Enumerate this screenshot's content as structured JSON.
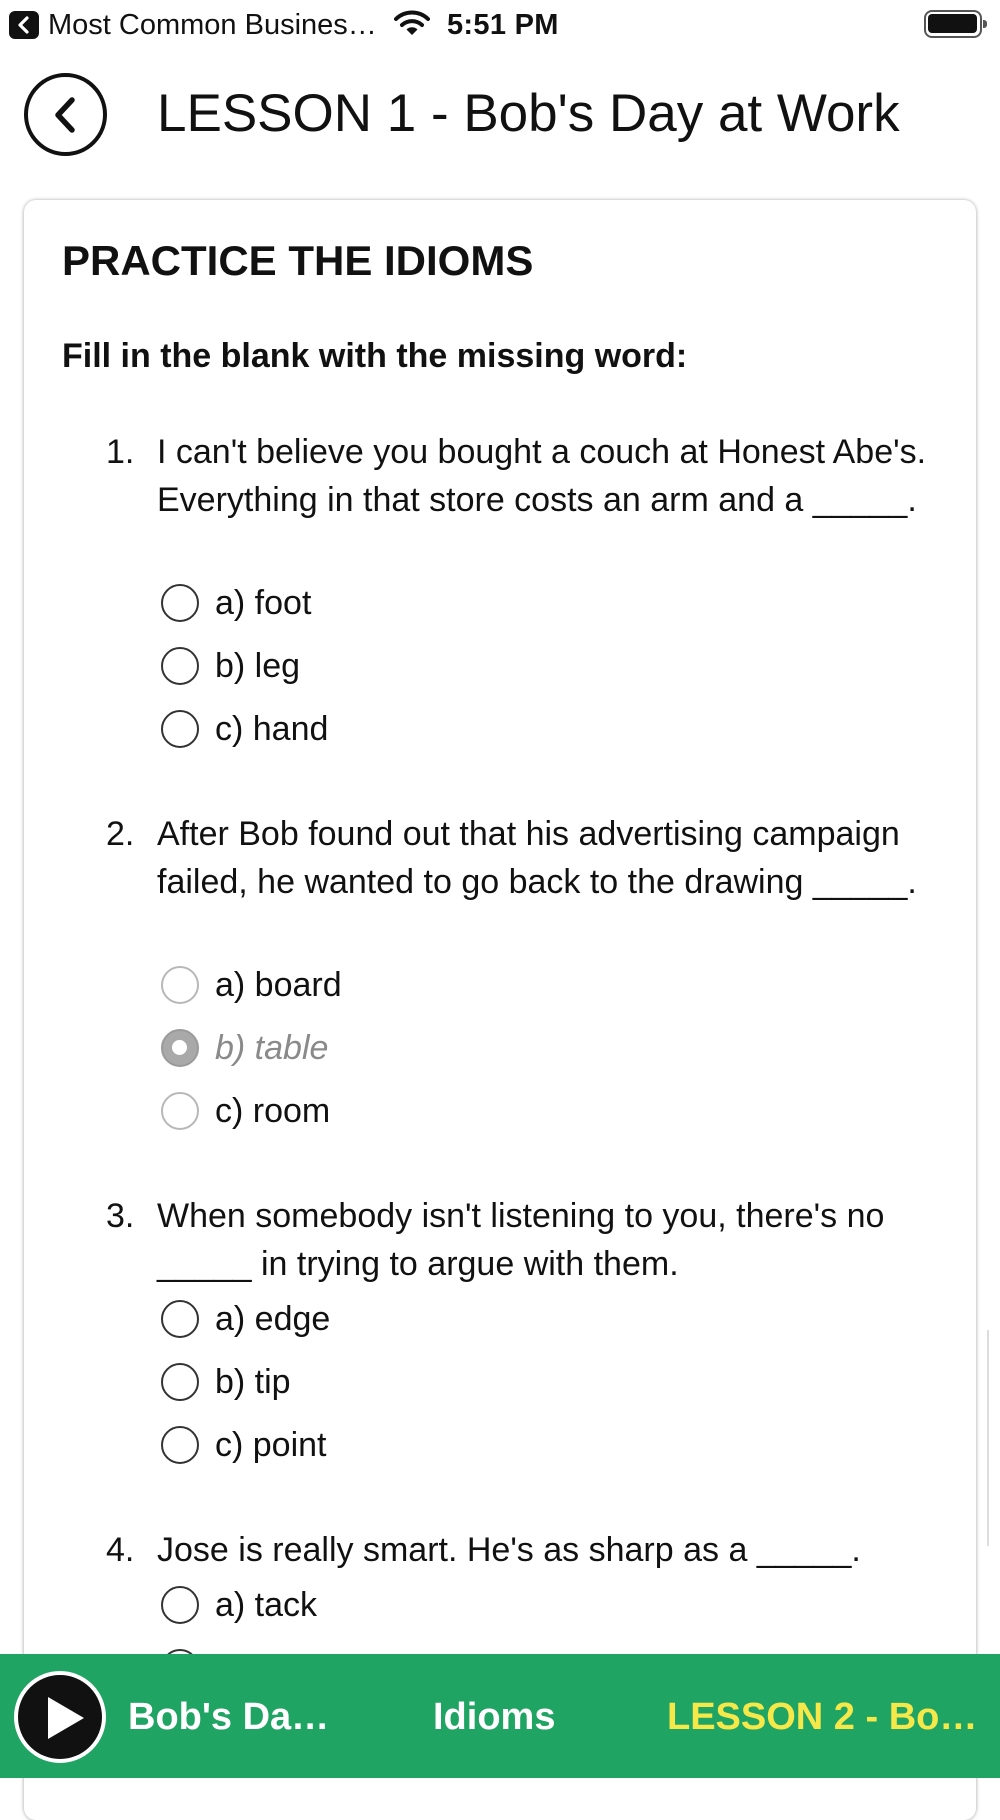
{
  "status_bar": {
    "back_app_name": "Most Common Busines…",
    "time": "5:51 PM"
  },
  "header": {
    "title": "LESSON 1 - Bob's Day at Work"
  },
  "section": {
    "title": "PRACTICE THE IDIOMS",
    "instruction": "Fill in the blank with the missing word:"
  },
  "questions": [
    {
      "number": "1.",
      "text": "I can't believe you bought a couch at Honest Abe's. Everything in that store costs an arm and a _____.",
      "options": [
        "a) foot",
        "b) leg",
        "c) hand"
      ],
      "selected": null
    },
    {
      "number": "2.",
      "text": "After Bob found out that his advertising campaign failed, he wanted to go back to the drawing _____.",
      "options": [
        "a) board",
        "b) table",
        "c) room"
      ],
      "selected": "b) table"
    },
    {
      "number": "3.",
      "text": "When somebody isn't listening to you, there's no _____ in trying to argue with them.",
      "options": [
        "a) edge",
        "b) tip",
        "c) point"
      ],
      "selected": null
    },
    {
      "number": "4.",
      "text": "Jose is really smart. He's as sharp as a _____.",
      "options": [
        "a) tack"
      ],
      "selected": null
    }
  ],
  "bottom_bar": {
    "current": "Bob's Da…",
    "section": "Idioms",
    "next": "LESSON 2 - Bo…"
  },
  "icons": {
    "status_back": "chevron-left-icon",
    "wifi": "wifi-icon",
    "battery": "battery-icon",
    "header_back": "chevron-left-circle-icon",
    "play": "play-icon"
  },
  "colors": {
    "bottom_bar_background": "#1fa463",
    "bottom_bar_text": "#ffffff",
    "next_lesson_text": "#f7e84a",
    "selected_option_text": "#8a8a8a"
  }
}
